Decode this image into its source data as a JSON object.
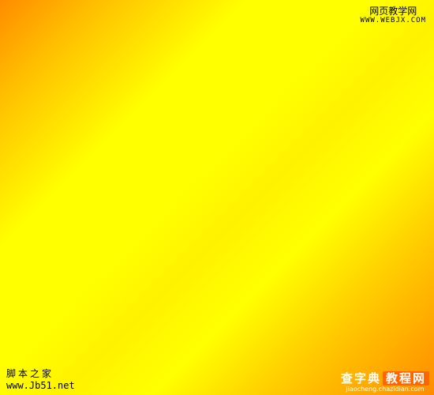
{
  "watermarks": {
    "top_right": {
      "cn": "网页教学网",
      "url": "WWW.WEBJX.COM"
    },
    "bottom_left": {
      "cn": "脚本之家",
      "url": "www.Jb51.net"
    },
    "bottom_right": {
      "cn_a": "查字典",
      "cn_b": "教程网",
      "url": "jiaocheng.chazidian.com"
    }
  },
  "colors": {
    "orange": "#ff8c00",
    "yellow": "#ffff00"
  }
}
